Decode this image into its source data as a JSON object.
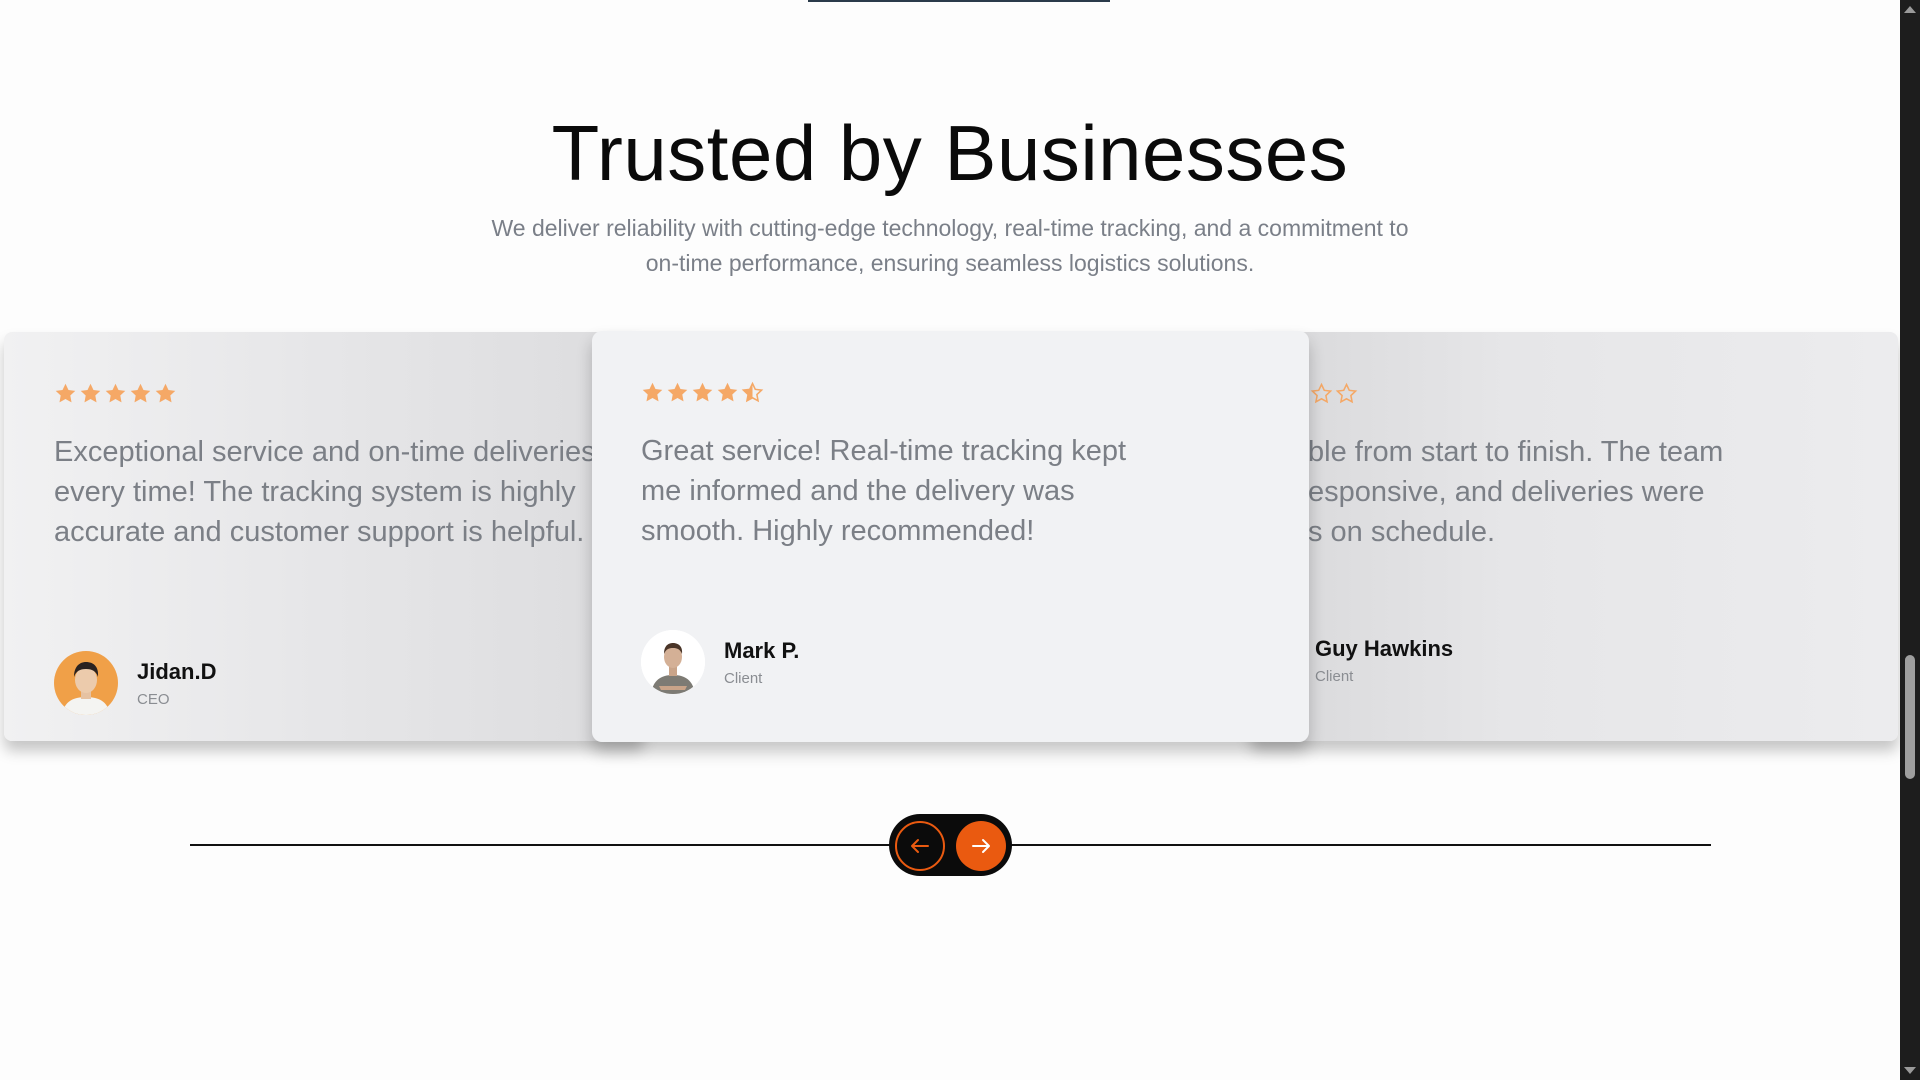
{
  "section": {
    "title": "Trusted by Businesses",
    "subtitle_line1": "We deliver reliability with cutting-edge technology, real-time tracking, and a commitment to",
    "subtitle_line2": "on-time performance, ensuring seamless logistics solutions."
  },
  "colors": {
    "accent": "#ea5a10",
    "star": "#f5a866",
    "text_muted": "#7b7f86"
  },
  "testimonials": [
    {
      "rating": 5,
      "quote": "Exceptional service and on-time deliveries every time! The tracking system is highly accurate and customer support is helpful.",
      "name": "Jidan.D",
      "role": "CEO",
      "avatar_icon": "person-avatar"
    },
    {
      "rating": 4.5,
      "quote": "Great service! Real-time tracking kept me informed and the delivery was smooth. Highly recommended!",
      "name": "Mark P.",
      "role": "Client",
      "avatar_icon": "person-avatar"
    },
    {
      "rating_visible_empty": 2,
      "quote_visible": "ble from start to finish. The team esponsive, and deliveries were s on schedule.",
      "quote_line1": "ble from start to finish. The team",
      "quote_line2": "esponsive, and deliveries were",
      "quote_line3": "s on schedule.",
      "name": "Guy Hawkins",
      "role": "Client"
    }
  ],
  "navigation": {
    "prev_icon": "arrow-left-icon",
    "next_icon": "arrow-right-icon"
  }
}
